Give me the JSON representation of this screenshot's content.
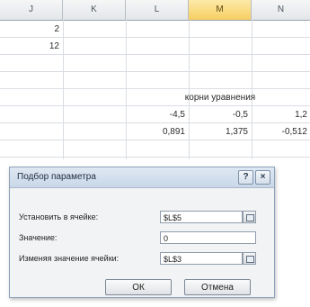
{
  "spreadsheet": {
    "columns": [
      "J",
      "K",
      "L",
      "M",
      "N"
    ],
    "cells": {
      "j2": "2",
      "j3": "12",
      "header": "корни уравнения",
      "roots": [
        "-4,5",
        "-0,5",
        "1,2"
      ],
      "values": [
        "0,891",
        "1,375",
        "-0,512"
      ]
    }
  },
  "dialog": {
    "title": "Подбор параметра",
    "help": "?",
    "close": "×",
    "set_cell_label": "Установить в ячейке:",
    "set_cell_value": "$L$5",
    "value_label": "Значение:",
    "value_value": "0",
    "changing_label": "Изменяя значение ячейки:",
    "changing_value": "$L$3",
    "ok": "ОК",
    "cancel": "Отмена"
  }
}
